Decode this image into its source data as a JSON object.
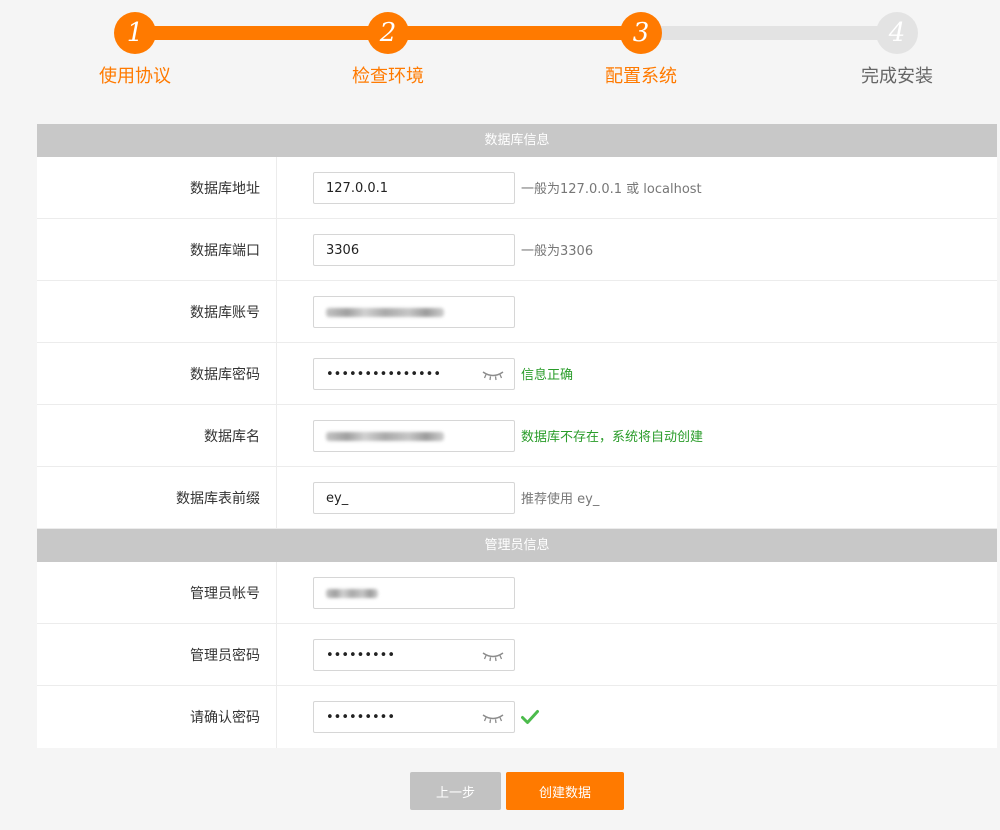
{
  "stepper": {
    "steps": [
      {
        "number": "1",
        "label": "使用协议",
        "state": "done"
      },
      {
        "number": "2",
        "label": "检查环境",
        "state": "done"
      },
      {
        "number": "3",
        "label": "配置系统",
        "state": "current"
      },
      {
        "number": "4",
        "label": "完成安装",
        "state": "todo"
      }
    ],
    "active_color": "#ff7a00",
    "inactive_color": "#e3e3e3"
  },
  "db_section": {
    "title": "数据库信息",
    "host": {
      "label": "数据库地址",
      "value": "127.0.0.1",
      "hint": "一般为127.0.0.1 或 localhost"
    },
    "port": {
      "label": "数据库端口",
      "value": "3306",
      "hint": "一般为3306"
    },
    "user": {
      "label": "数据库账号",
      "value": ""
    },
    "password": {
      "label": "数据库密码",
      "masked_value": "•••••••••••••••",
      "status": "信息正确"
    },
    "name": {
      "label": "数据库名",
      "value": "",
      "status": "数据库不存在，系统将自动创建"
    },
    "prefix": {
      "label": "数据库表前缀",
      "value": "ey_",
      "hint": "推荐使用 ey_"
    }
  },
  "admin_section": {
    "title": "管理员信息",
    "account": {
      "label": "管理员帐号",
      "value": ""
    },
    "password": {
      "label": "管理员密码",
      "masked_value": "•••••••••"
    },
    "confirm": {
      "label": "请确认密码",
      "masked_value": "•••••••••"
    }
  },
  "actions": {
    "prev_label": "上一步",
    "next_label": "创建数据"
  },
  "icons": {
    "eye": "eye-closed-icon",
    "check": "check-icon"
  },
  "colors": {
    "accent": "#ff7a00",
    "success": "#2a9c2a",
    "section_header": "#c8c8c8"
  }
}
